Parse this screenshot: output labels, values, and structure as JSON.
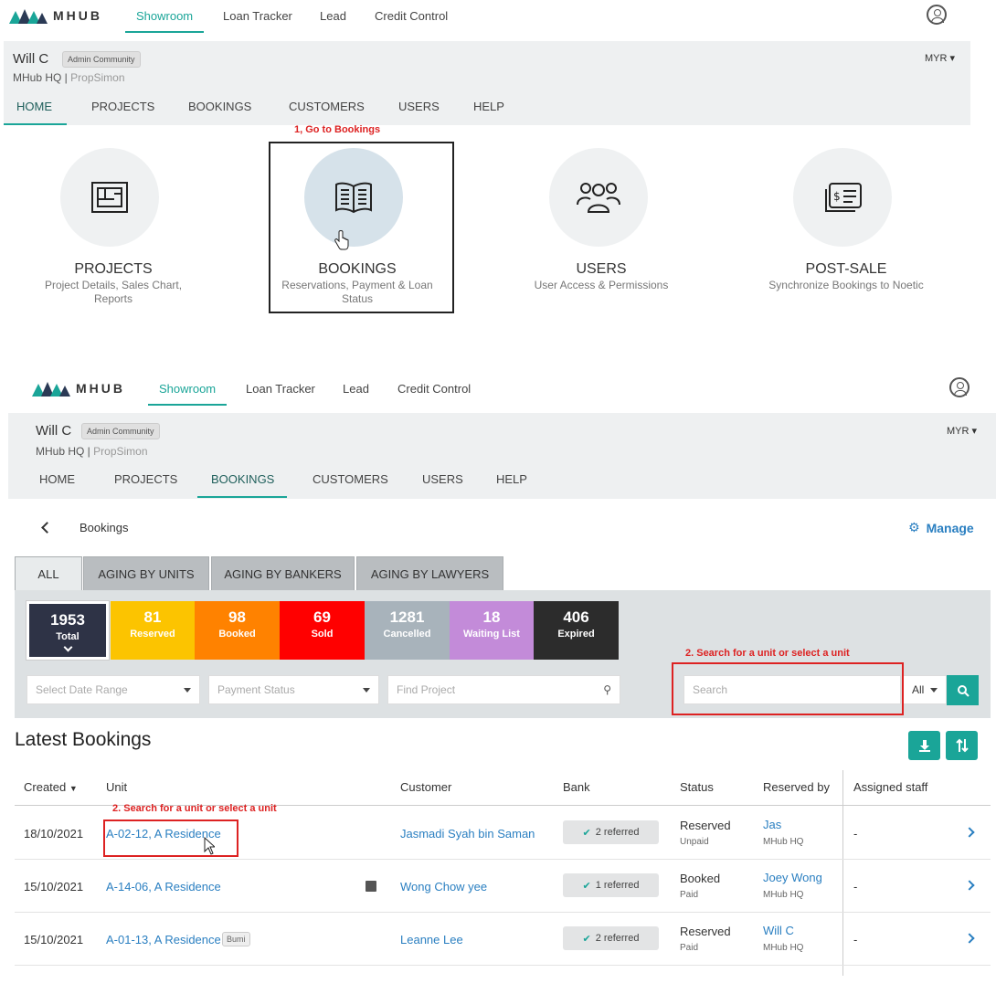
{
  "brand": {
    "logo_text": "MHUB"
  },
  "topnav": {
    "items": [
      "Showroom",
      "Loan Tracker",
      "Lead",
      "Credit Control"
    ]
  },
  "user": {
    "name": "Will C",
    "badge": "Admin Community",
    "org": "MHub HQ",
    "org_sep": " | ",
    "org_sub": "PropSimon",
    "currency": "MYR"
  },
  "tabs": [
    "HOME",
    "PROJECTS",
    "BOOKINGS",
    "CUSTOMERS",
    "USERS",
    "HELP"
  ],
  "annotations": {
    "step1": "1, Go to Bookings",
    "step2": "2. Search for a unit or select a unit"
  },
  "tiles": [
    {
      "title": "PROJECTS",
      "sub": "Project Details, Sales Chart, Reports",
      "icon": "blueprint-icon"
    },
    {
      "title": "BOOKINGS",
      "sub": "Reservations, Payment & Loan Status",
      "icon": "book-icon"
    },
    {
      "title": "USERS",
      "sub": "User Access & Permissions",
      "icon": "users-icon"
    },
    {
      "title": "POST-SALE",
      "sub": "Synchronize Bookings to Noetic",
      "icon": "bill-icon"
    }
  ],
  "bookings_page": {
    "breadcrumb": "Bookings",
    "manage": "Manage",
    "filter_tabs": [
      "ALL",
      "AGING BY UNITS",
      "AGING BY BANKERS",
      "AGING BY LAWYERS"
    ],
    "stats": [
      {
        "num": "1953",
        "label": "Total",
        "color": "#2e3346"
      },
      {
        "num": "81",
        "label": "Reserved",
        "color": "#fcc400"
      },
      {
        "num": "98",
        "label": "Booked",
        "color": "#ff8200"
      },
      {
        "num": "69",
        "label": "Sold",
        "color": "#ff0000"
      },
      {
        "num": "1281",
        "label": "Cancelled",
        "color": "#a8b3bb"
      },
      {
        "num": "18",
        "label": "Waiting List",
        "color": "#c38bd9"
      },
      {
        "num": "406",
        "label": "Expired",
        "color": "#2c2c2c"
      }
    ],
    "date_range_placeholder": "Select Date Range",
    "payment_status_placeholder": "Payment Status",
    "find_project_placeholder": "Find Project",
    "search_placeholder": "Search",
    "search_scope": "All",
    "latest_title": "Latest Bookings",
    "columns": [
      "Created",
      "Unit",
      "Customer",
      "Bank",
      "Status",
      "Reserved by",
      "Assigned staff"
    ],
    "rows": [
      {
        "created": "18/10/2021",
        "unit": "A-02-12, A Residence",
        "customer": "Jasmadi Syah bin Saman",
        "bank": "2 referred",
        "status": "Reserved",
        "payment": "Unpaid",
        "reserved_by": "Jas",
        "reserved_org": "MHub HQ",
        "staff": "-"
      },
      {
        "created": "15/10/2021",
        "unit": "A-14-06, A Residence",
        "customer": "Wong Chow yee",
        "bank": "1 referred",
        "status": "Booked",
        "payment": "Paid",
        "reserved_by": "Joey Wong",
        "reserved_org": "MHub HQ",
        "staff": "-"
      },
      {
        "created": "15/10/2021",
        "unit": "A-01-13, A Residence",
        "tag": "Bumi",
        "customer": "Leanne Lee",
        "bank": "2 referred",
        "status": "Reserved",
        "payment": "Paid",
        "reserved_by": "Will C",
        "reserved_org": "MHub HQ",
        "staff": "-"
      }
    ]
  },
  "colors": {
    "accent": "#1aa598",
    "link": "#2a7fc1",
    "annotation": "#dd2222"
  }
}
